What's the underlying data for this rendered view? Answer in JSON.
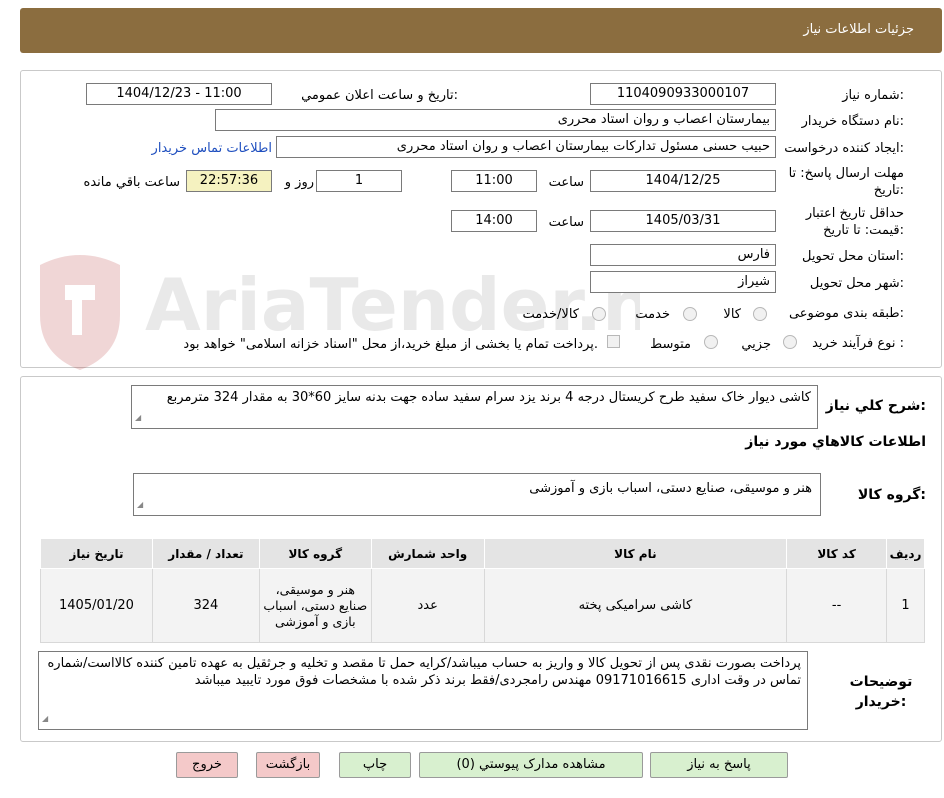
{
  "header": {
    "title": "جزئیات اطلاعات نیاز"
  },
  "watermark": {
    "text": "AriaTender.neT"
  },
  "form": {
    "need_number_label": "شماره نیاز:",
    "need_number": "1104090933000107",
    "announce_label": "تاریخ و ساعت اعلان عمومي:",
    "announce_value": "1404/12/23 - 11:00",
    "buyer_org_label": "نام دستگاه خریدار:",
    "buyer_org": "بیمارستان اعصاب و روان استاد محرری",
    "requester_label": "ایجاد کننده درخواست:",
    "requester": "حبیب حسنی مسئول تدارکات بیمارستان اعصاب و روان استاد محرری",
    "contact_link": "اطلاعات تماس خریدار",
    "deadline_label": "مهلت ارسال پاسخ: تا تاریخ:",
    "deadline_date": "1404/12/25",
    "time_label": "ساعت",
    "deadline_time": "11:00",
    "days_value": "1",
    "days_label": "روز و",
    "remaining_time": "22:57:36",
    "remaining_label": "ساعت باقي مانده",
    "validity_label": "حداقل تاریخ اعتبار قیمت: تا تاریخ:",
    "validity_date": "1405/03/31",
    "validity_time": "14:00",
    "province_label": "استان محل تحویل:",
    "province": "فارس",
    "city_label": "شهر محل تحویل:",
    "city": "شیراز",
    "category_label": "طبقه بندی موضوعی:",
    "category_options": [
      "کالا",
      "خدمت",
      "کالا/خدمت"
    ],
    "process_label": "نوع فرآیند خرید :",
    "process_options": [
      "جزیي",
      "متوسط"
    ],
    "process_note": "پرداخت تمام یا بخشی از مبلغ خرید،از محل \"اسناد خزانه اسلامی\" خواهد بود."
  },
  "description": {
    "label": "شرح کلي نياز:",
    "text": "کاشی دیوار خاک سفید طرح کریستال درجه 4 برند یزد سرام سفید ساده جهت بدنه سایز 60*30 به مقدار 324 مترمربع"
  },
  "goods": {
    "section_title": "اطلاعات کالاهاي مورد نياز",
    "group_label": "گروه کالا:",
    "group_value": "هنر و موسیقی، صنایع دستی، اسباب بازی و آموزشی"
  },
  "table": {
    "headers": [
      "رديف",
      "کد کالا",
      "نام کالا",
      "واحد شمارش",
      "گروه کالا",
      "تعداد / مقدار",
      "تاريخ نياز"
    ],
    "rows": [
      [
        "1",
        "--",
        "کاشی سرامیکی پخته",
        "عدد",
        "هنر و موسیقی، صنایع دستی، اسباب بازی و آموزشی",
        "324",
        "1405/01/20"
      ]
    ]
  },
  "notes": {
    "label": "توضیحات خریدار:",
    "text": "پرداخت بصورت نقدی پس از تحویل کالا و واریز به حساب میباشد/کرایه حمل تا مقصد و تخلیه و جرثقیل به عهده تامین کننده کالااست/شماره تماس در وقت اداری 09171016615 مهندس رامجردی/فقط برند ذکر شده با مشخصات فوق مورد تایبید میباشد"
  },
  "buttons": {
    "reply": "پاسخ به نیاز",
    "attachments": "مشاهده مدارک پیوستي (0)",
    "print": "چاپ",
    "back": "بازگشت",
    "exit": "خروج"
  }
}
